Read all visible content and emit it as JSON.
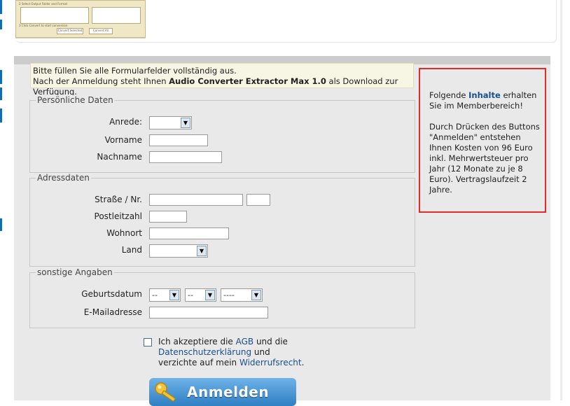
{
  "notice": {
    "line1": "Bitte füllen Sie alle Formularfelder vollständig aus.",
    "line2_pre": "Nach der Anmeldung steht Ihnen ",
    "product": "Audio Converter Extractor Max 1.0",
    "line2_post": " als Download zur Verfügung."
  },
  "personal": {
    "legend": "Persönliche Daten",
    "salutation_label": "Anrede:",
    "firstname_label": "Vorname",
    "lastname_label": "Nachname"
  },
  "address": {
    "legend": "Adressdaten",
    "street_label": "Straße / Nr.",
    "zip_label": "Postleitzahl",
    "city_label": "Wohnort",
    "country_label": "Land"
  },
  "other": {
    "legend": "sonstige Angaben",
    "birthdate_label": "Geburtsdatum",
    "day_value": "--",
    "month_value": "--",
    "year_value": "----",
    "email_label": "E-Mailadresse"
  },
  "terms": {
    "pre": "Ich akzeptiere die ",
    "agb": "AGB",
    "mid": " und die ",
    "privacy": "Datenschutzerklärung",
    "mid2": " und verzichte auf mein ",
    "revocation": "Widerrufsrecht",
    "end": "."
  },
  "submit_label": "Anmelden",
  "info": {
    "pre": "Folgende ",
    "highlight": "Inhalte",
    "post": " erhalten Sie im Memberbereich!",
    "cost_text": "Durch Drücken des Buttons \"Anmelden\" entstehen Ihnen Kosten von 96 Euro inkl. Mehrwertsteuer pro Jahr (12 Monate zu je 8 Euro). Vertragslaufzeit 2 Jahre."
  },
  "thumbnail": {
    "step2": "2  Select Output Folder and Format",
    "step3": "3  Click Convert to start conversion",
    "convert_selected": "Convert Selected",
    "convert_all": "Convert All"
  },
  "colors": {
    "highlight_border": "#e12a2a",
    "link": "#1a4f8a",
    "button": "#2f7fc3"
  }
}
